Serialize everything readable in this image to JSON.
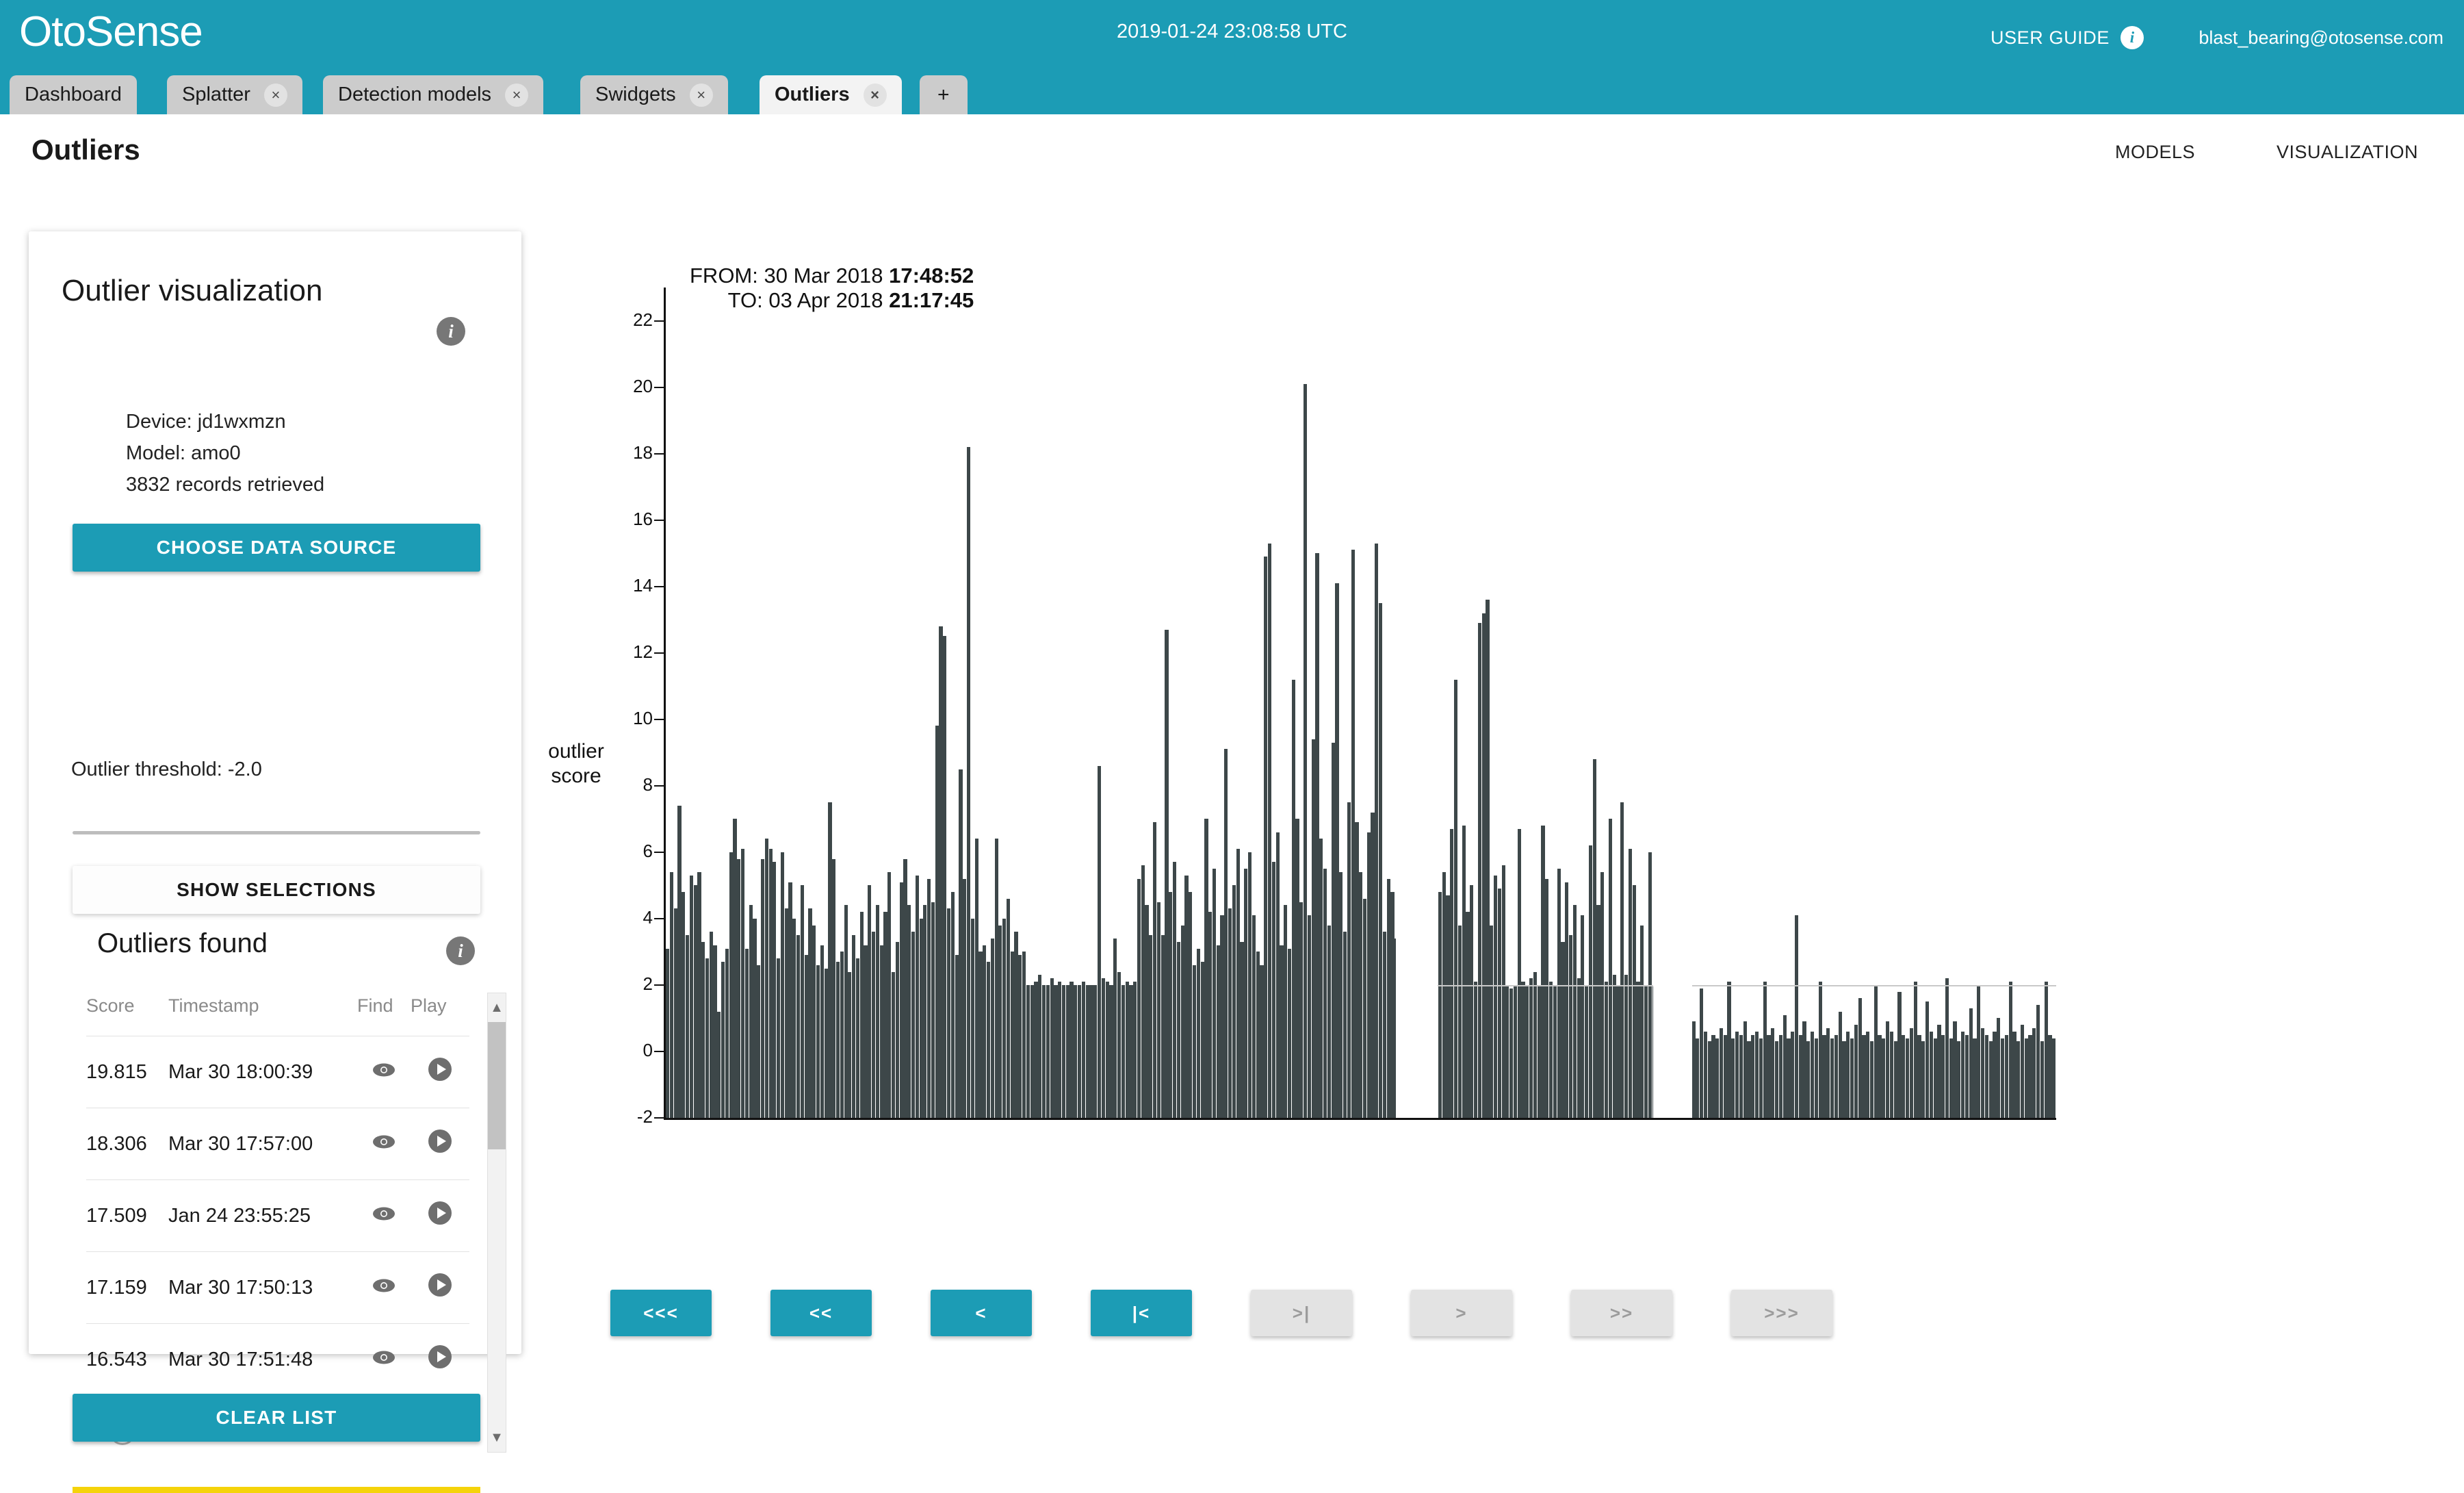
{
  "header": {
    "brand": "OtoSense",
    "clock": "2019-01-24 23:08:58 UTC",
    "user_guide_label": "USER GUIDE",
    "info_glyph": "i",
    "user_email": "blast_bearing@otosense.com",
    "accent_color": "#1c9cb5"
  },
  "tabs": [
    {
      "label": "Dashboard",
      "closable": false,
      "active": false
    },
    {
      "label": "Splatter",
      "close_glyph": "×",
      "closable": true,
      "active": false
    },
    {
      "label": "Detection models",
      "close_glyph": "×",
      "closable": true,
      "active": false
    },
    {
      "label": "Swidgets",
      "close_glyph": "×",
      "closable": true,
      "active": false
    },
    {
      "label": "Outliers",
      "close_glyph": "×",
      "closable": true,
      "active": true
    }
  ],
  "add_tab_label": "+",
  "page": {
    "title": "Outliers",
    "nav": [
      {
        "label": "MODELS"
      },
      {
        "label": "VISUALIZATION"
      }
    ]
  },
  "sidebar": {
    "viz_title": "Outlier visualization",
    "viz_info_glyph": "i",
    "device_line": "Device: jd1wxmzn",
    "model_line": "Model: amo0",
    "records_line": "3832 records retrieved",
    "choose_source_label": "CHOOSE DATA SOURCE",
    "threshold_label": "Outlier threshold: -2.0",
    "threshold_value": -2.0,
    "show_selections_label": "SHOW SELECTIONS",
    "found_title": "Outliers found",
    "found_info_glyph": "i",
    "clear_list_label": "CLEAR LIST",
    "table": {
      "columns": [
        "Score",
        "Timestamp",
        "Find",
        "Play"
      ],
      "rows": [
        {
          "score": "19.815",
          "timestamp": "Mar 30 18:00:39",
          "find_icon": "eye-icon",
          "play_icon": "play-icon"
        },
        {
          "score": "18.306",
          "timestamp": "Mar 30 17:57:00",
          "find_icon": "eye-icon",
          "play_icon": "play-icon"
        },
        {
          "score": "17.509",
          "timestamp": "Jan 24 23:55:25",
          "find_icon": "eye-icon",
          "play_icon": "play-icon"
        },
        {
          "score": "17.159",
          "timestamp": "Mar 30 17:50:13",
          "find_icon": "eye-icon",
          "play_icon": "play-icon"
        },
        {
          "score": "16.543",
          "timestamp": "Mar 30 17:51:48",
          "find_icon": "eye-icon",
          "play_icon": "play-icon"
        }
      ]
    },
    "scroll_up_glyph": "▲",
    "scroll_down_glyph": "▼"
  },
  "chart_range": {
    "from_label": "FROM: 30 Mar 2018",
    "from_time": "17:48:52",
    "to_label": "TO: 03 Apr 2018",
    "to_time": "21:17:45"
  },
  "pager": [
    {
      "label": "<<<",
      "enabled": true
    },
    {
      "label": "<<",
      "enabled": true
    },
    {
      "label": "<",
      "enabled": true
    },
    {
      "label": "|<",
      "enabled": true
    },
    {
      "label": ">|",
      "enabled": false
    },
    {
      "label": ">",
      "enabled": false
    },
    {
      "label": ">>",
      "enabled": false
    },
    {
      "label": ">>>",
      "enabled": false
    }
  ],
  "chart_data": {
    "type": "bar",
    "title": "",
    "xlabel": "",
    "ylabel": "outlier\nscore",
    "ylabel_lines": [
      "outlier",
      "score"
    ],
    "ylim": [
      -2,
      23
    ],
    "yticks": [
      -2,
      0,
      2,
      4,
      6,
      8,
      10,
      12,
      14,
      16,
      18,
      20,
      22
    ],
    "grid": false,
    "legend": null,
    "bar_color": "#3d4749",
    "threshold": 2.0,
    "threshold_color": "#c9c9c9",
    "baseline": -2,
    "annotations": [
      "FROM: 30 Mar 2018 17:48:52",
      "TO: 03 Apr 2018 21:17:45"
    ],
    "segments": [
      {
        "name": "segment-1",
        "x_start_pct": 0.0,
        "x_end_pct": 52.5,
        "floor": 2.0,
        "note": "dense high-activity block, peaks to 18.2"
      },
      {
        "name": "segment-2",
        "x_start_pct": 55.5,
        "x_end_pct": 71.0,
        "floor": 2.0,
        "note": "mid block, peaks to 8.8"
      },
      {
        "name": "segment-3",
        "x_start_pct": 73.8,
        "x_end_pct": 100.0,
        "floor": 0.3,
        "note": "low block with spikes to 4.1, threshold line at 2.1"
      }
    ],
    "values": [
      3.1,
      5.4,
      4.3,
      7.4,
      4.8,
      3.5,
      5.3,
      5.0,
      5.4,
      3.3,
      2.8,
      3.6,
      3.2,
      1.2,
      2.7,
      3.1,
      6.0,
      7.0,
      5.8,
      6.1,
      3.1,
      4.4,
      4.0,
      2.6,
      5.8,
      6.4,
      6.1,
      5.7,
      2.8,
      6.0,
      4.3,
      5.1,
      4.0,
      3.5,
      5.0,
      2.9,
      4.3,
      3.8,
      2.6,
      3.2,
      2.5,
      7.5,
      5.8,
      2.7,
      3.0,
      4.4,
      2.4,
      3.5,
      2.8,
      4.2,
      3.2,
      5.0,
      3.6,
      4.4,
      3.2,
      4.2,
      5.4,
      2.4,
      3.3,
      5.1,
      5.8,
      4.4,
      3.6,
      5.3,
      4.0,
      4.4,
      5.2,
      4.5,
      9.8,
      12.8,
      12.5,
      4.3,
      4.8,
      2.9,
      8.5,
      5.2,
      18.2,
      4.0,
      6.4,
      3.0,
      3.2,
      2.7,
      3.4,
      6.4,
      3.8,
      4.0,
      4.6,
      3.0,
      3.6,
      2.9,
      3.0,
      2.0,
      2.0,
      2.1,
      2.3,
      2.0,
      2.0,
      2.2,
      2.0,
      2.1,
      2.0,
      2.0,
      2.1,
      2.0,
      2.0,
      2.1,
      2.0,
      2.0,
      2.0,
      8.6,
      2.2,
      2.1,
      2.0,
      3.4,
      2.4,
      2.0,
      2.1,
      2.0,
      2.1,
      5.2,
      5.6,
      4.4,
      3.5,
      6.9,
      4.5,
      3.5,
      12.7,
      4.8,
      5.7,
      3.3,
      3.8,
      5.3,
      4.8,
      2.6,
      3.1,
      2.7,
      7.0,
      4.2,
      5.5,
      3.2,
      4.1,
      9.1,
      4.3,
      5.0,
      6.1,
      3.3,
      5.5,
      6.0,
      4.1,
      3.0,
      2.6,
      14.9,
      15.3,
      5.7,
      6.6,
      3.2,
      4.4,
      3.1,
      11.2,
      7.0,
      4.5,
      20.1,
      4.1,
      9.4,
      15.0,
      6.4,
      5.5,
      3.8,
      9.3,
      14.1,
      5.4,
      3.6,
      7.5,
      15.1,
      6.9,
      5.4,
      4.6,
      6.6,
      7.2,
      15.3,
      13.5,
      3.6,
      5.2,
      4.8,
      3.4,
      5.1,
      3.8,
      4.5,
      12.2,
      14.2,
      3.9,
      13.5,
      5.8,
      3.7,
      13.4,
      4.8,
      5.4,
      4.7,
      6.7,
      11.2,
      3.8,
      6.8,
      4.2,
      5.0,
      2.1,
      12.9,
      13.2,
      13.6,
      3.8,
      5.3,
      4.9,
      5.6,
      2.0,
      1.9,
      2.0,
      6.7,
      2.1,
      2.0,
      2.2,
      2.4,
      2.0,
      6.8,
      5.2,
      2.1,
      2.0,
      5.5,
      3.3,
      5.1,
      3.5,
      4.4,
      2.2,
      4.1,
      2.0,
      6.2,
      8.8,
      4.4,
      5.4,
      2.1,
      7.0,
      2.3,
      2.0,
      7.5,
      2.3,
      6.1,
      5.0,
      2.1,
      3.8,
      2.0,
      6.0,
      2.0,
      2.1,
      4.8,
      2.2,
      6.8,
      2.0,
      0.4,
      2.1,
      0.6,
      0.5,
      0.9,
      0.4,
      1.9,
      0.6,
      0.3,
      0.5,
      0.4,
      0.7,
      0.5,
      2.1,
      0.4,
      0.6,
      0.5,
      0.9,
      0.3,
      0.5,
      0.6,
      0.4,
      2.1,
      0.5,
      0.7,
      0.3,
      0.5,
      1.1,
      0.4,
      0.6,
      4.1,
      0.5,
      0.9,
      0.3,
      0.6,
      0.4,
      2.1,
      0.5,
      0.7,
      0.4,
      0.5,
      1.2,
      0.3,
      0.6,
      0.4,
      0.8,
      1.6,
      0.5,
      0.6,
      0.3,
      2.0,
      0.5,
      0.4,
      0.9,
      0.6,
      0.3,
      1.8,
      0.5,
      0.4,
      0.7,
      2.1,
      0.5,
      0.3,
      1.5,
      0.6,
      0.4,
      0.8,
      0.5,
      2.2,
      0.4,
      0.9,
      0.3,
      0.6,
      0.5,
      1.3,
      0.4,
      2.0,
      0.7,
      0.5,
      0.3,
      0.6,
      1.0,
      0.4,
      0.5,
      2.1,
      0.6,
      0.3,
      0.8,
      0.4,
      0.5,
      0.7,
      1.4,
      0.3,
      2.1,
      0.5,
      0.4
    ]
  }
}
